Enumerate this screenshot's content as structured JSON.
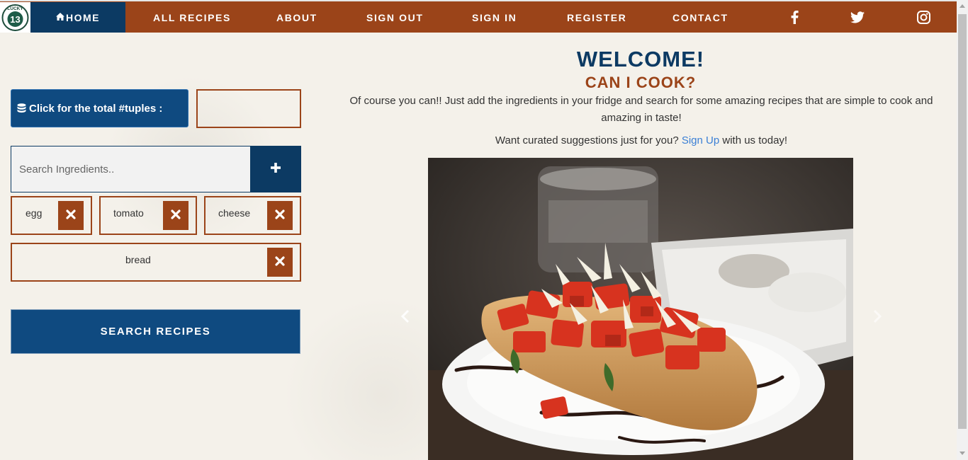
{
  "logo": {
    "alt_text": "LUCKY 13"
  },
  "nav": {
    "home": "HOME",
    "items": [
      "ALL RECIPES",
      "ABOUT",
      "SIGN OUT",
      "SIGN IN",
      "REGISTER",
      "CONTACT"
    ],
    "social": [
      "facebook-icon",
      "twitter-icon",
      "instagram-icon"
    ]
  },
  "tuples": {
    "label": "Click for the total #tuples :",
    "value": ""
  },
  "search": {
    "placeholder": "Search Ingredients..",
    "value": ""
  },
  "ingredients": [
    "egg",
    "tomato",
    "cheese",
    "bread"
  ],
  "search_button": "SEARCH RECIPES",
  "hero": {
    "title": "WELCOME!",
    "subtitle": "CAN I COOK?",
    "intro": "Of course you can!! Just add the ingredients in your fridge and search for some amazing recipes that are simple to cook and amazing in taste!",
    "curated_before": "Want curated suggestions just for you?",
    "curated_link": "Sign Up",
    "curated_after": "with us today!"
  },
  "carousel": {
    "image": "bruschetta-photo"
  },
  "colors": {
    "brand_orange": "#9b4419",
    "brand_navy": "#0c3a63",
    "button_blue": "#0f4a80",
    "link_blue": "#3a7fd5"
  }
}
